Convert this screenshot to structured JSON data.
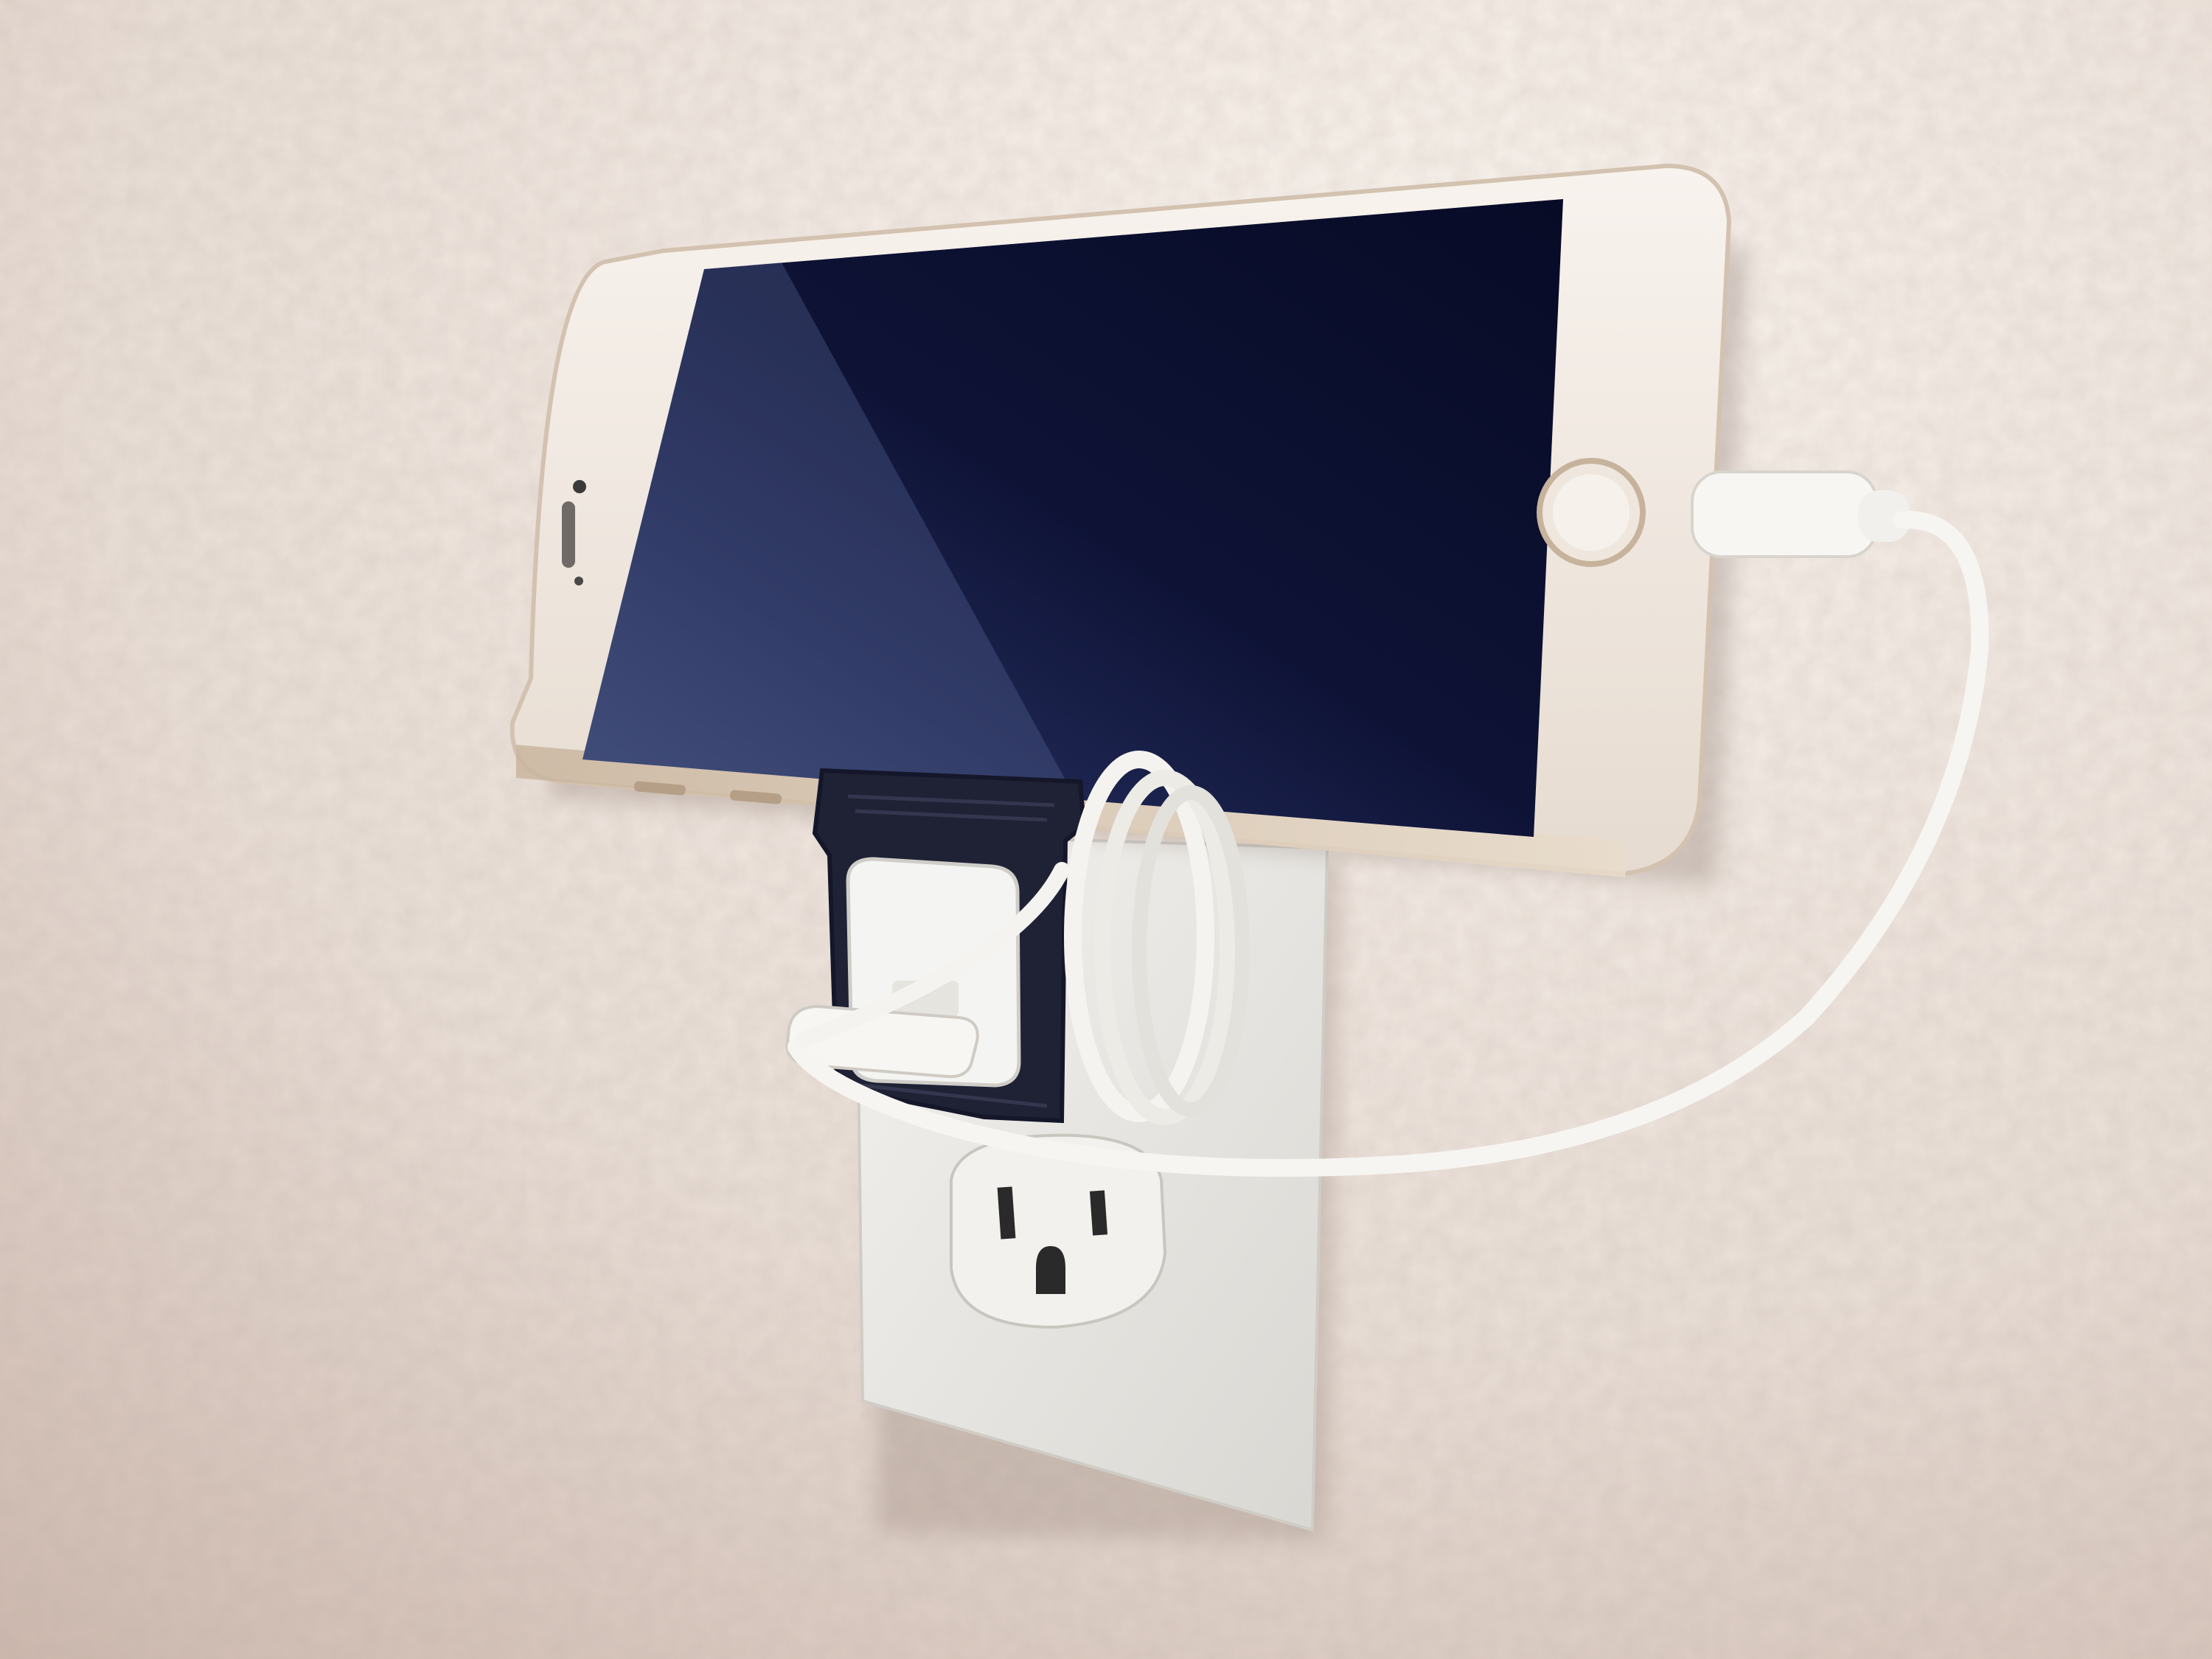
{
  "scene": {
    "kind": "photograph",
    "palette": {
      "wall_light": "#f4ece6",
      "wall_shadow": "#cdbab0",
      "phone_body": "#f1ebe4",
      "phone_rim": "#d9c8b6",
      "screen": "#0c1030",
      "screen_glare": "#4c5a86",
      "holder": "#1f2135",
      "charger": "#f4f4f2",
      "cable": "#f7f5f2",
      "outlet_plate": "#ecebe8"
    }
  }
}
